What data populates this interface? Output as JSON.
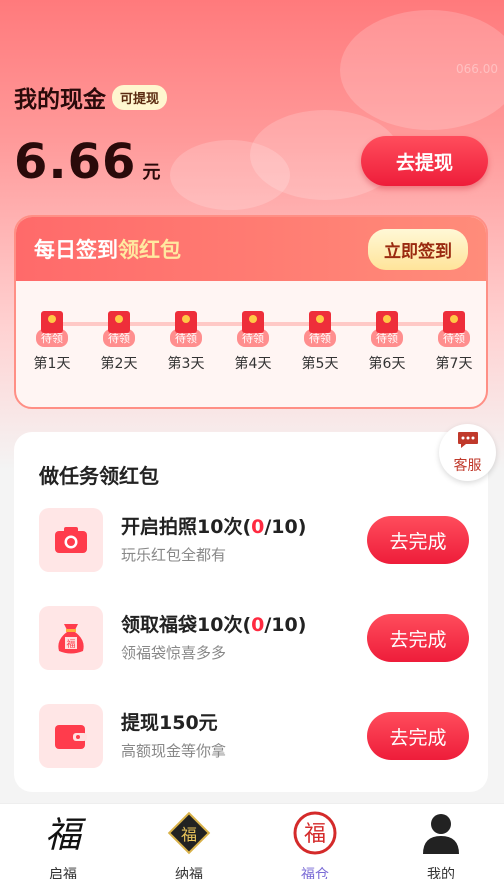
{
  "cash": {
    "title": "我的现金",
    "badge": "可提现",
    "amount": "6.66",
    "unit": "元",
    "withdraw_label": "去提现",
    "watermark": "066.00"
  },
  "signin": {
    "title_part1": "每日签到",
    "title_part2": "领红包",
    "button_label": "立即签到",
    "days": [
      {
        "label": "第1天",
        "status": "待领"
      },
      {
        "label": "第2天",
        "status": "待领"
      },
      {
        "label": "第3天",
        "status": "待领"
      },
      {
        "label": "第4天",
        "status": "待领"
      },
      {
        "label": "第5天",
        "status": "待领"
      },
      {
        "label": "第6天",
        "status": "待领"
      },
      {
        "label": "第7天",
        "status": "待领"
      }
    ]
  },
  "tasks": {
    "heading": "做任务领红包",
    "items": [
      {
        "title_prefix": "开启拍照10次(",
        "progress_now": "0",
        "title_suffix": "/10)",
        "desc": "玩乐红包全都有",
        "button": "去完成",
        "icon": "camera-icon"
      },
      {
        "title_prefix": "领取福袋10次(",
        "progress_now": "0",
        "title_suffix": "/10)",
        "desc": "领福袋惊喜多多",
        "button": "去完成",
        "icon": "lucky-bag-icon"
      },
      {
        "title_prefix": "提现150元",
        "progress_now": "",
        "title_suffix": "",
        "desc": "高额现金等你拿",
        "button": "去完成",
        "icon": "wallet-icon"
      }
    ]
  },
  "service": {
    "label": "客服",
    "icon": "chat-bubble-icon"
  },
  "tabbar": {
    "items": [
      {
        "label": "启福",
        "icon": "fu-calligraphy-icon"
      },
      {
        "label": "纳福",
        "icon": "fu-diamond-icon"
      },
      {
        "label": "福仓",
        "icon": "fu-circle-icon"
      },
      {
        "label": "我的",
        "icon": "user-icon"
      }
    ],
    "active": "福仓",
    "active_color": "#7a6bd6"
  },
  "colors": {
    "accent": "#ee1d3a",
    "card_border": "#ff8f85"
  }
}
